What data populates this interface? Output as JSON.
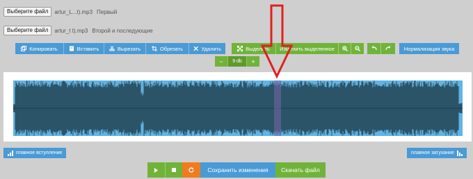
{
  "files": [
    {
      "button": "Выберите файл",
      "name": "artur_L...t).mp3",
      "desc": "Первый"
    },
    {
      "button": "Выберите файл",
      "name": "artur_t   t).mp3",
      "desc": "Второй и последующие"
    }
  ],
  "toolbar": {
    "copy": "Копировать",
    "paste": "Вставить",
    "cut": "Вырезать",
    "crop": "Обрезать",
    "delete": "Удалить",
    "select": "Выделить",
    "edit_selection": "Изменить выделенное",
    "normalize": "Нормализация звука"
  },
  "zoom": {
    "minus": "−",
    "value": "9 db",
    "plus": "+"
  },
  "fades": {
    "fade_in": "плавное вступление",
    "fade_out": "плавное затухание"
  },
  "bottom": {
    "save": "Сохранить изменения",
    "download": "Скачать файл"
  },
  "colors": {
    "blue": "#4a9ad6",
    "green": "#71b33a",
    "orange": "#f07c1e",
    "wave_bg": "#61b4e4",
    "wave_fg": "#2b5468",
    "arrow": "#e02020"
  },
  "icons": [
    "copy-icon",
    "paste-icon",
    "cut-icon",
    "crop-icon",
    "close-icon",
    "expand-icon",
    "zoom-in-icon",
    "zoom-out-icon",
    "undo-icon",
    "redo-icon",
    "play-icon",
    "stop-icon",
    "reload-icon",
    "bars-icon"
  ]
}
